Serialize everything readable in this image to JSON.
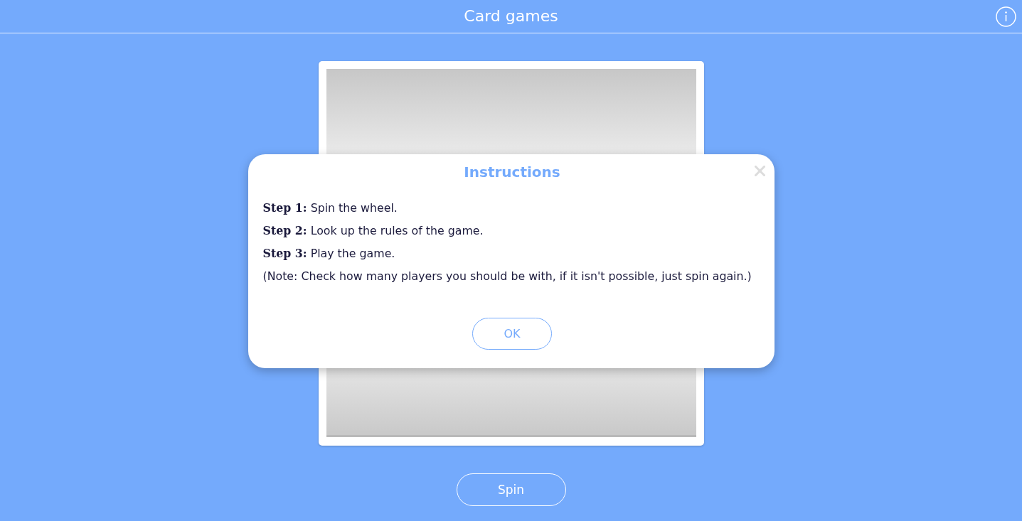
{
  "header": {
    "title": "Card games"
  },
  "spin_button": {
    "label": "Spin"
  },
  "dialog": {
    "title": "Instructions",
    "lines": [
      "**Step 1:** Spin the wheel.",
      "**Step 2:** Look up the rules of the game.",
      "**Step 3:** Play the game.",
      "(Note: Check how many players you should be with, if it isn't possible, just spin again.)"
    ],
    "ok_button": {
      "label": "OK"
    }
  }
}
